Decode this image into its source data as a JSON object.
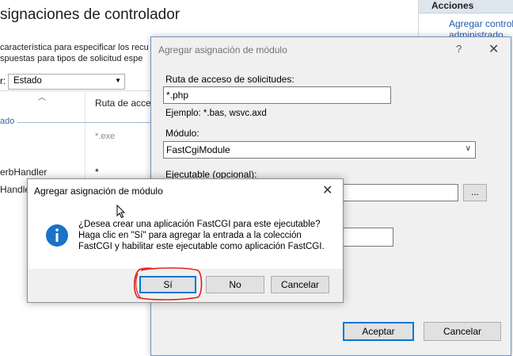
{
  "background_page": {
    "title": "signaciones de controlador",
    "description_line1": "característica para especificar los recu",
    "description_line2": "spuestas para tipos de solicitud espe",
    "group_by_label": "r:",
    "group_by_value": "Estado",
    "column_header": "Ruta de acces",
    "group_label": "ado",
    "cell_exe": "*.exe",
    "cell_handler1": "erbHandler",
    "cell_star": "*",
    "cell_handler2": "Handle"
  },
  "actions_panel": {
    "header": "Acciones",
    "link_line1": "Agregar controlador",
    "link_line2": "administrado"
  },
  "module_dialog": {
    "title": "Agregar asignación de módulo",
    "help_glyph": "?",
    "close_glyph": "✕",
    "path_label": "Ruta de acceso de solicitudes:",
    "path_value": "*.php",
    "path_example": "Ejemplo: *.bas, wsvc.axd",
    "module_label": "Módulo:",
    "module_value": "FastCgiModule",
    "executable_label": "Ejecutable (opcional):",
    "browse_label": "...",
    "accept_label": "Aceptar",
    "cancel_label": "Cancelar"
  },
  "message_box": {
    "title": "Agregar asignación de módulo",
    "close_glyph": "✕",
    "icon": "info-icon",
    "message_line1": "¿Desea crear una aplicación FastCGI para este ejecutable?",
    "message_line2": "Haga clic en \"Sí\" para agregar la entrada a la colección",
    "message_line3": "FastCGI y habilitar este ejecutable como aplicación FastCGI.",
    "yes_label": "Sí",
    "no_label": "No",
    "cancel_label": "Cancelar"
  },
  "colors": {
    "accent_focus": "#0078d7",
    "annotation_red": "#e0201e",
    "info_blue": "#1a73c8",
    "link_blue": "#1f5bb3"
  }
}
